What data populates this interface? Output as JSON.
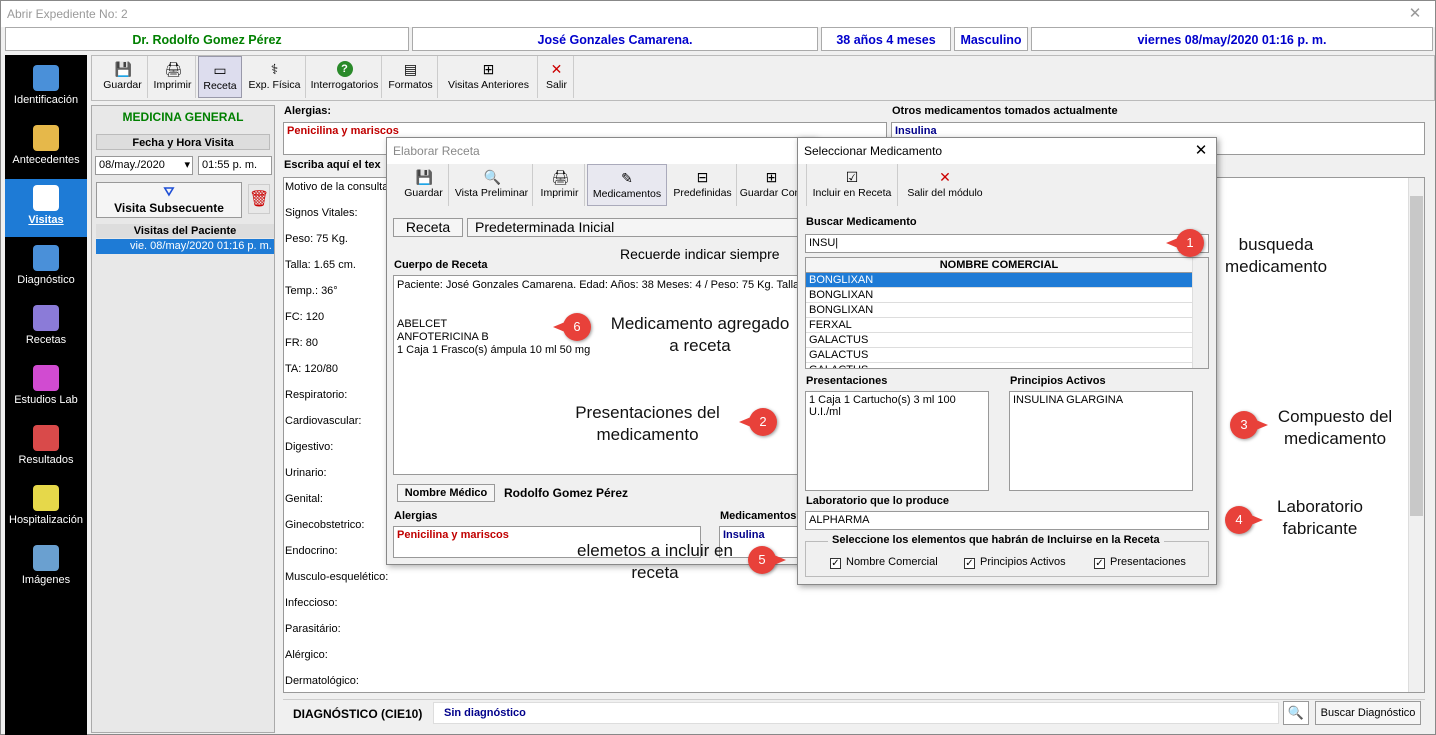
{
  "window": {
    "title": "Abrir Expediente No: 2",
    "close": "✕"
  },
  "header": {
    "doctor": "Dr. Rodolfo Gomez Pérez",
    "patient": "José Gonzales Camarena.",
    "age": "38 años 4 meses",
    "sex": "Masculino",
    "date": "viernes 08/may/2020 01:16 p. m."
  },
  "sidebar": {
    "items": [
      {
        "label": "Identificación",
        "icon": "person-icon",
        "color": "#4a90d9"
      },
      {
        "label": "Antecedentes",
        "icon": "folder-medical-icon",
        "color": "#e6b84a"
      },
      {
        "label": "Visitas",
        "icon": "pencil-notepad-icon",
        "color": "#ffffff"
      },
      {
        "label": "Diagnóstico",
        "icon": "stack-tray-icon",
        "color": "#4a90d9"
      },
      {
        "label": "Recetas",
        "icon": "prescription-icon",
        "color": "#8b7bd8"
      },
      {
        "label": "Estudios Lab",
        "icon": "flask-icon",
        "color": "#d14bd1"
      },
      {
        "label": "Resultados",
        "icon": "clipboard-check-icon",
        "color": "#d94a4a"
      },
      {
        "label": "Hospitalización",
        "icon": "ambulance-icon",
        "color": "#e6d84a"
      },
      {
        "label": "Imágenes",
        "icon": "scanner-icon",
        "color": "#6aa0d0"
      }
    ]
  },
  "toolbar": {
    "items": [
      {
        "label": "Guardar",
        "icon": "floppy-icon",
        "glyph": "💾"
      },
      {
        "label": "Imprimir",
        "icon": "printer-icon",
        "glyph": "🖨"
      },
      {
        "label": "Receta",
        "icon": "window-icon",
        "glyph": "▭"
      },
      {
        "label": "Exp. Física",
        "icon": "stethoscope-icon",
        "glyph": "⚕"
      },
      {
        "label": "Interrogatorios",
        "icon": "question-icon",
        "glyph": "?"
      },
      {
        "label": "Formatos",
        "icon": "document-icon",
        "glyph": "▤"
      },
      {
        "label": "Visitas Anteriores",
        "icon": "history-icon",
        "glyph": "⊞"
      },
      {
        "label": "Salir",
        "icon": "close-red-icon",
        "glyph": "✕"
      }
    ]
  },
  "left": {
    "section": "MEDICINA GENERAL",
    "fecha_hora": "Fecha y Hora Visita",
    "date": "08/may./2020",
    "time": "01:55 p. m.",
    "visit_btn": "Visita Subsecuente",
    "visits_title": "Visitas del Paciente",
    "visit_item": "vie. 08/may/2020 01:16 p. m."
  },
  "main": {
    "allergies_label": "Alergias:",
    "allergies": "Penicilina y mariscos",
    "other_meds_label": "Otros medicamentos tomados actualmente",
    "other_meds": "Insulina",
    "write_label": "Escriba aquí el tex",
    "vitals": [
      "Motivo de la consulta",
      "Signos Vitales:",
      "Peso: 75 Kg.",
      "Talla: 1.65  cm.",
      "Temp.:  36°",
      "FC: 120",
      "FR: 80",
      "TA: 120/80",
      "Respiratorio:",
      "Cardiovascular:",
      "Digestivo:",
      "Urinario:",
      "Genital:",
      "Ginecobstetrico:",
      "Endocrino:",
      "Musculo-esquelético:",
      "Infeccioso:",
      "Parasitário:",
      "Alérgico:",
      "Dermatológico:"
    ],
    "diag_label": "DIAGNÓSTICO (CIE10)",
    "diag_value": "Sin diagnóstico",
    "diag_btn": "Buscar Diagnóstico"
  },
  "receta": {
    "title": "Elaborar Receta",
    "toolbar": [
      {
        "label": "Guardar",
        "glyph": "💾"
      },
      {
        "label": "Vista Preliminar",
        "glyph": "🔍"
      },
      {
        "label": "Imprimir",
        "glyph": "🖨"
      },
      {
        "label": "Medicamentos",
        "glyph": "✎"
      },
      {
        "label": "Predefinidas",
        "glyph": "⊟"
      },
      {
        "label": "Guardar Com",
        "glyph": "⊞"
      }
    ],
    "tab1": "Receta",
    "tab2": "Predeterminada Inicial",
    "reminder": "Recuerde indicar siempre",
    "body_label": "Cuerpo de Receta",
    "body_lines": [
      "Paciente: José Gonzales Camarena. Edad: Años: 38 Meses: 4 / Peso: 75 Kg.   Talla:",
      "",
      "",
      "ABELCET",
      "ANFOTERICINA B",
      "1 Caja 1 Frasco(s) ámpula 10 ml 50 mg"
    ],
    "doc_label": "Nombre Médico",
    "doc_value": "Rodolfo Gomez Pérez",
    "allergies_label": "Alergias",
    "allergies": "Penicilina y mariscos",
    "meds_label": "Medicamentos",
    "meds": "Insulina"
  },
  "selector": {
    "title": "Seleccionar Medicamento",
    "close": "✕",
    "include_btn": "Incluir en Receta",
    "exit_btn": "Salir del módulo",
    "search_label": "Buscar Medicamento",
    "search_value": "INSU",
    "col_header": "NOMBRE COMERCIAL",
    "rows": [
      "BONGLIXAN",
      "BONGLIXAN",
      "BONGLIXAN",
      "FERXAL",
      "GALACTUS",
      "GALACTUS",
      "GALACTUS"
    ],
    "pres_label": "Presentaciones",
    "pres_value": "1 Caja 1 Cartucho(s) 3 ml 100 U.I./ml",
    "princ_label": "Principios Activos",
    "princ_value": "INSULINA GLARGINA",
    "lab_label": "Laboratorio que lo produce",
    "lab_value": "ALPHARMA",
    "group_title": "Seleccione los elementos que habrán de Incluirse en la Receta",
    "checks": [
      {
        "label": "Nombre Comercial",
        "checked": true
      },
      {
        "label": "Principios Activos",
        "checked": true
      },
      {
        "label": "Presentaciones",
        "checked": true
      }
    ]
  },
  "annotations": [
    {
      "n": "1",
      "text": "busqueda medicamento"
    },
    {
      "n": "2",
      "text": "Presentaciones del medicamento"
    },
    {
      "n": "3",
      "text": "Compuesto del medicamento"
    },
    {
      "n": "4",
      "text": "Laboratorio fabricante"
    },
    {
      "n": "5",
      "text": "elemetos a incluir en receta"
    },
    {
      "n": "6",
      "text": "Medicamento agregado a receta"
    }
  ],
  "colors": {
    "accent": "#1e7bd6",
    "header_text": "#0000cc",
    "doctor_text": "#008000",
    "annotation": "#e8413a",
    "section_green": "#008000"
  }
}
